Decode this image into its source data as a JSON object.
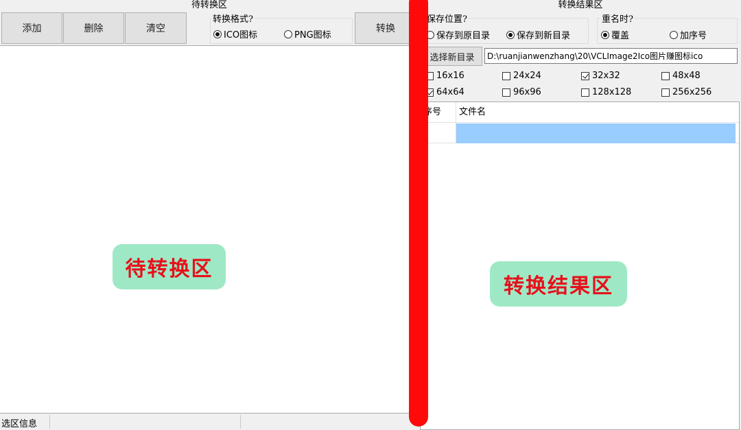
{
  "left": {
    "title": "待转换区",
    "buttons": {
      "add": "添加",
      "delete": "删除",
      "clear": "清空",
      "convert": "转换"
    },
    "format": {
      "title": "转换格式?",
      "options": [
        "ICO图标",
        "PNG图标"
      ],
      "selected": "ICO图标"
    },
    "overlay_label": "待转换区",
    "status": "选区信息"
  },
  "right": {
    "title": "转换结果区",
    "save_location": {
      "title": "保存位置?",
      "options": [
        "保存到原目录",
        "保存到新目录"
      ],
      "selected": "保存到新目录"
    },
    "rename": {
      "title": "重名时?",
      "options": [
        "覆盖",
        "加序号"
      ],
      "selected": "覆盖"
    },
    "select_dir_button": "选择新目录",
    "dir_path": "D:\\ruanjianwenzhang\\20\\VCLImage2Ico图片赚图标ico",
    "sizes": [
      {
        "label": "16x16",
        "checked": false
      },
      {
        "label": "24x24",
        "checked": false
      },
      {
        "label": "32x32",
        "checked": true
      },
      {
        "label": "48x48",
        "checked": false
      },
      {
        "label": "64x64",
        "checked": true
      },
      {
        "label": "96x96",
        "checked": false
      },
      {
        "label": "128x128",
        "checked": false
      },
      {
        "label": "256x256",
        "checked": false
      }
    ],
    "table": {
      "columns": [
        "序号",
        "文件名"
      ]
    },
    "overlay_label": "转换结果区"
  },
  "colors": {
    "divider": "#ff0a0a",
    "sticker_bg": "#9ee8c6",
    "sticker_text": "#e8101a",
    "row_highlight": "#99ccff"
  }
}
